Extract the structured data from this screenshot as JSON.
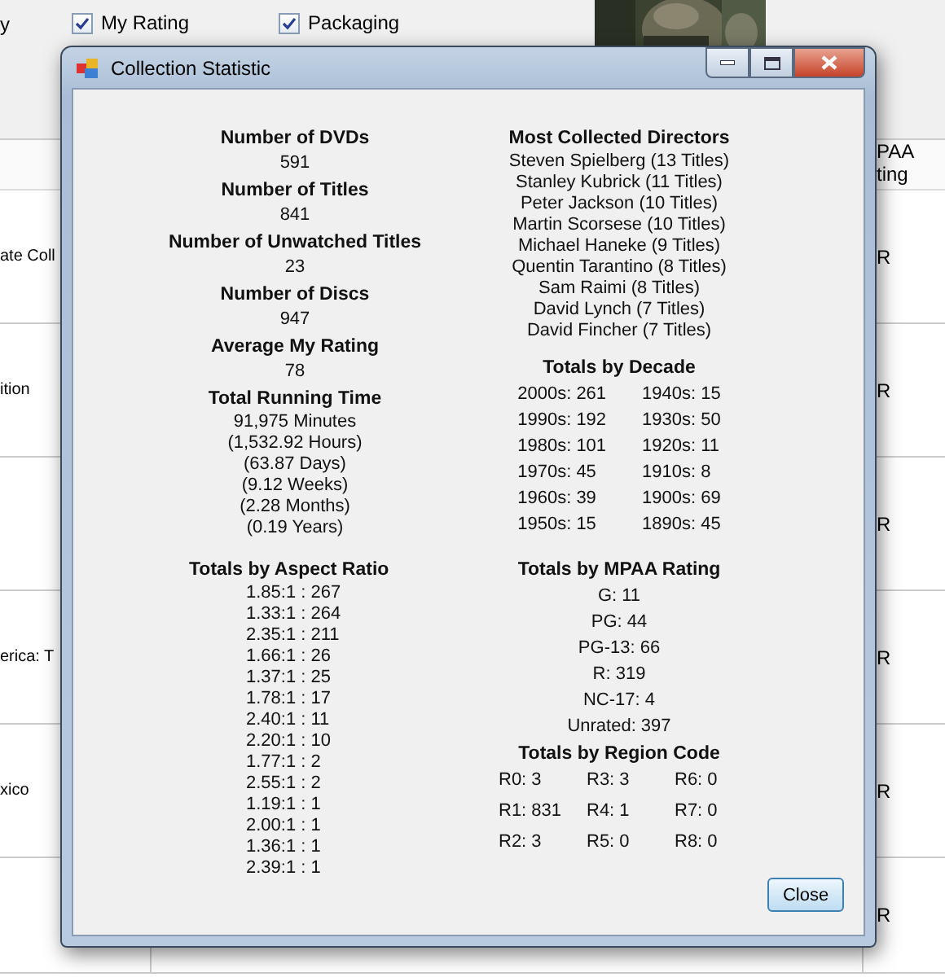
{
  "background": {
    "leading_text": "y",
    "checkboxes": [
      {
        "label": "My Rating",
        "checked": true
      },
      {
        "label": "Packaging",
        "checked": true
      }
    ],
    "table": {
      "rating_header": "PAA ting",
      "rows": [
        {
          "title": "ate Coll",
          "rating": "R"
        },
        {
          "title": "ition",
          "rating": "R"
        },
        {
          "rating": "R"
        },
        {
          "title": "erica: T",
          "rating": "R"
        },
        {
          "title": "xico",
          "rating": "R"
        },
        {
          "rating": "R"
        }
      ]
    }
  },
  "dialog": {
    "title": "Collection Statistic",
    "blocks": [
      {
        "left": [
          {
            "kind": "value",
            "heading": "Number of DVDs",
            "items": [
              "591"
            ]
          },
          {
            "kind": "value",
            "heading": "Number of Titles",
            "items": [
              "841"
            ]
          },
          {
            "kind": "value",
            "heading": "Number of Unwatched Titles",
            "items": [
              "23"
            ]
          },
          {
            "kind": "value",
            "heading": "Number of Discs",
            "items": [
              "947"
            ]
          },
          {
            "kind": "value",
            "heading": "Average My Rating",
            "items": [
              "78"
            ]
          },
          {
            "kind": "list",
            "heading": "Total Running Time",
            "items": [
              "91,975 Minutes",
              "(1,532.92 Hours)",
              "(63.87 Days)",
              "(9.12 Weeks)",
              "(2.28 Months)",
              "(0.19 Years)"
            ]
          }
        ],
        "right": [
          {
            "kind": "list",
            "heading": "Most Collected Directors",
            "items": [
              "Steven Spielberg (13 Titles)",
              "Stanley Kubrick (11 Titles)",
              "Peter Jackson (10 Titles)",
              "Martin Scorsese (10 Titles)",
              "Michael Haneke (9 Titles)",
              "Quentin Tarantino (8 Titles)",
              "Sam Raimi (8 Titles)",
              "David Lynch (7 Titles)",
              "David Fincher (7 Titles)"
            ]
          },
          {
            "kind": "twocol",
            "heading": "Totals by Decade",
            "items": [
              "2000s: 261",
              "1990s: 192",
              "1980s: 101",
              "1970s: 45",
              "1960s: 39",
              "1950s: 15",
              "1940s: 15",
              "1930s: 50",
              "1920s: 11",
              "1910s: 8",
              "1900s: 69",
              "1890s: 45"
            ]
          }
        ]
      },
      {
        "left": [
          {
            "kind": "aligned",
            "heading": "Totals by Aspect Ratio",
            "items": [
              "1.85:1 : 267",
              "1.33:1 : 264",
              "2.35:1 : 211",
              "1.66:1 : 26",
              "1.37:1 : 25",
              "1.78:1 : 17",
              "2.40:1 : 11",
              "2.20:1 : 10",
              "1.77:1 : 2",
              "2.55:1 : 2",
              "1.19:1 : 1",
              "2.00:1 : 1",
              "1.36:1 : 1",
              "2.39:1 : 1"
            ]
          }
        ],
        "right": [
          {
            "kind": "value",
            "heading": "Totals by MPAA Rating",
            "items": [
              "G: 11",
              "PG: 44",
              "PG-13: 66",
              "R: 319",
              "NC-17: 4",
              "Unrated: 397"
            ]
          },
          {
            "kind": "threecol",
            "heading": "Totals by Region Code",
            "items": [
              "R0: 3",
              "R1: 831",
              "R2: 3",
              "R3: 3",
              "R4: 1",
              "R5: 0",
              "R6: 0",
              "R7: 0",
              "R8: 0"
            ]
          }
        ]
      }
    ],
    "close_button": "Close"
  }
}
